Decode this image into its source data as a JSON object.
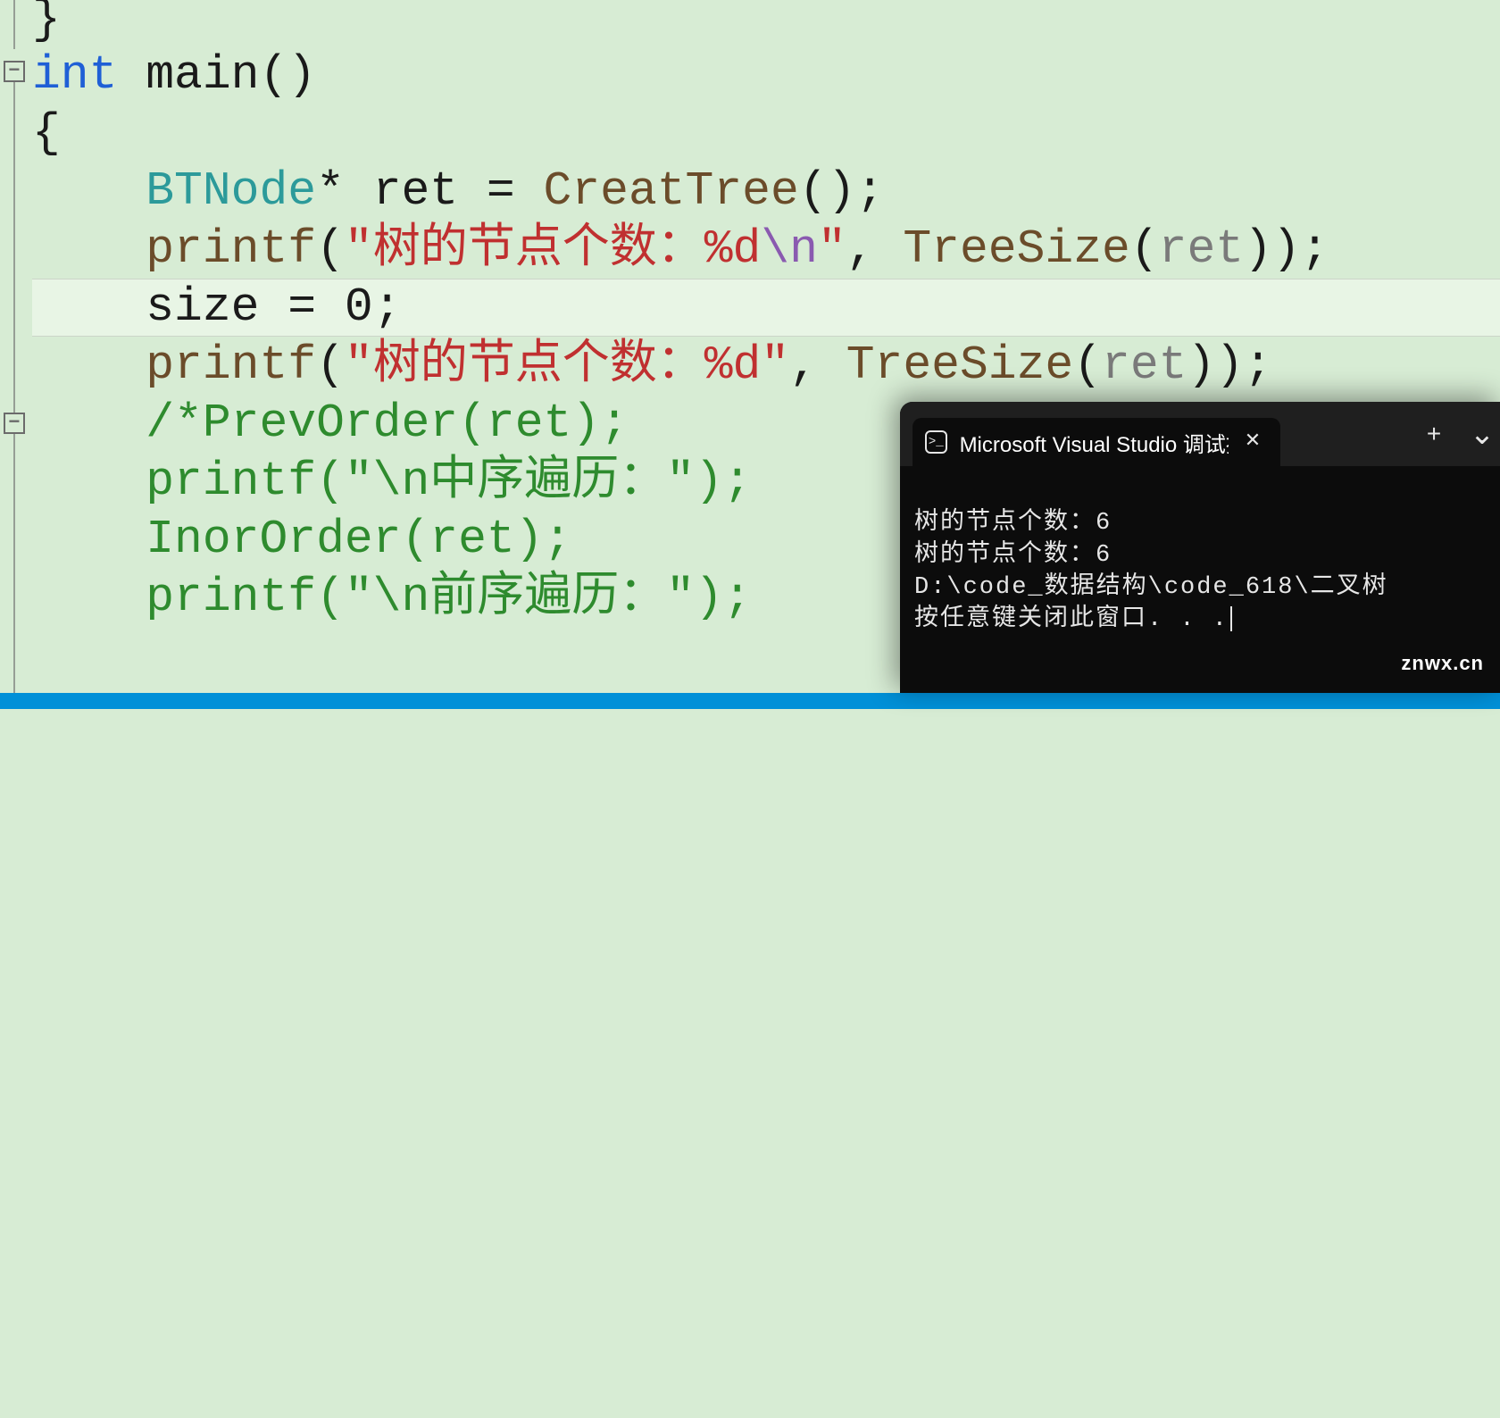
{
  "editor": {
    "outline_minus": "−",
    "lines": {
      "l0_brace": "}",
      "l1_int": "int",
      "l1_main": " main()",
      "l2_brace": "{",
      "l3_indent": "    ",
      "l3_type": "BTNode",
      "l3_rest1": "* ret = ",
      "l3_func": "CreatTree",
      "l3_rest2": "();",
      "l4_indent": "    ",
      "l4_printf": "printf",
      "l4_paren": "(",
      "l4_str_a": "\"树的节点个数：%d",
      "l4_esc": "\\n",
      "l4_str_b": "\"",
      "l4_rest1": ", ",
      "l4_func2": "TreeSize",
      "l4_paren2": "(",
      "l4_arg": "ret",
      "l4_rest2": "));",
      "l5_indent": "    ",
      "l5_text": "size = ",
      "l5_num": "0",
      "l5_semi": ";",
      "l6_indent": "    ",
      "l6_printf": "printf",
      "l6_paren": "(",
      "l6_str": "\"树的节点个数：%d\"",
      "l6_rest1": ", ",
      "l6_func2": "TreeSize",
      "l6_paren2": "(",
      "l6_arg": "ret",
      "l6_rest2": "));",
      "l7_indent": "    ",
      "l7_comment": "/*PrevOrder(ret);",
      "l8_indent": "    ",
      "l8_comment": "printf(\"\\n中序遍历：\");",
      "l9_indent": "    ",
      "l9_comment": "InorOrder(ret);",
      "l10_indent": "    ",
      "l10_comment": "printf(\"\\n前序遍历：\");"
    }
  },
  "terminal": {
    "tab_title": "Microsoft Visual Studio 调试控",
    "tab_close": "✕",
    "new_tab": "+",
    "dropdown": "⌄",
    "lines": [
      "树的节点个数：6",
      "树的节点个数：6",
      "D:\\code_数据结构\\code_618\\二叉树",
      "按任意键关闭此窗口. . ."
    ]
  },
  "watermark": "znwx.cn"
}
